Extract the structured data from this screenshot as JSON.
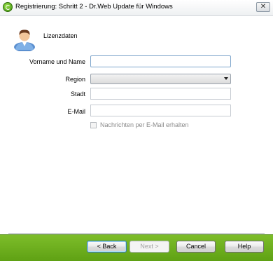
{
  "window": {
    "title": "Registrierung: Schritt 2 - Dr.Web Update für Windows",
    "close_glyph": "✕"
  },
  "section": {
    "title": "Lizenzdaten",
    "icon": "user-icon"
  },
  "form": {
    "name_label": "Vorname und Name",
    "name_value": "",
    "region_label": "Region",
    "region_value": "",
    "city_label": "Stadt",
    "city_value": "",
    "email_label": "E-Mail",
    "email_value": "",
    "newsletter_label": "Nachrichten per E-Mail erhalten",
    "newsletter_checked": false
  },
  "buttons": {
    "back": "< Back",
    "next": "Next >",
    "cancel": "Cancel",
    "help": "Help"
  },
  "colors": {
    "footer_green": "#6cae1d",
    "focus_border": "#7fa6cc"
  }
}
